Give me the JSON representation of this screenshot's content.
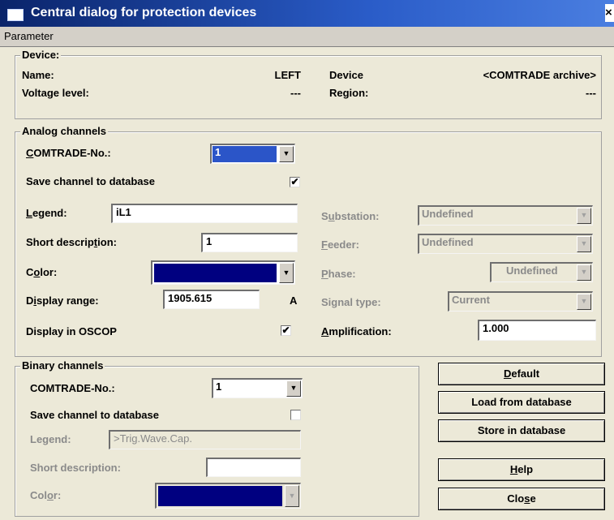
{
  "window": {
    "title": "Central dialog for protection devices",
    "close_glyph": "×"
  },
  "menu": {
    "parameter": "Parameter"
  },
  "device": {
    "group_label": "Device:",
    "name_label": "Name:",
    "name_value": "LEFT",
    "device_label": "Device",
    "device_value": "<COMTRADE archive>",
    "voltage_label": "Voltage level:",
    "voltage_value": "---",
    "region_label": "Region:",
    "region_value": "---"
  },
  "analog": {
    "group_label": "Analog channels",
    "comtrade_label": "COMTRADE-No.:",
    "comtrade_value": "1",
    "save_label": "Save channel to database",
    "save_checked": "✔",
    "legend_label": "Legend:",
    "legend_value": "iL1",
    "short_label": "Short description:",
    "short_value": "1",
    "color_label": "Color:",
    "color_hex": "#000080",
    "range_label": "Display range:",
    "range_value": "1905.615",
    "range_unit": "A",
    "oscop_label": "Display in OSCOP",
    "oscop_checked": "✔",
    "substation_label": "Substation:",
    "substation_value": "Undefined",
    "feeder_label": "Feeder:",
    "feeder_value": "Undefined",
    "phase_label": "Phase:",
    "phase_value": "Undefined",
    "signal_label": "Signal type:",
    "signal_value": "Current",
    "amp_label": "Amplification:",
    "amp_value": "1.000"
  },
  "binary": {
    "group_label": "Binary channels",
    "comtrade_label": "COMTRADE-No.:",
    "comtrade_value": "1",
    "save_label": "Save channel to database",
    "legend_label": "Legend:",
    "legend_value": ">Trig.Wave.Cap.",
    "short_label": "Short description:",
    "short_value": "",
    "color_label": "Color:",
    "color_hex": "#000080"
  },
  "buttons": {
    "default": "Default",
    "load": "Load from database",
    "store": "Store in database",
    "help": "Help",
    "close": "Close"
  },
  "icons": {
    "dropdown": "▼",
    "window": "window-icon"
  }
}
